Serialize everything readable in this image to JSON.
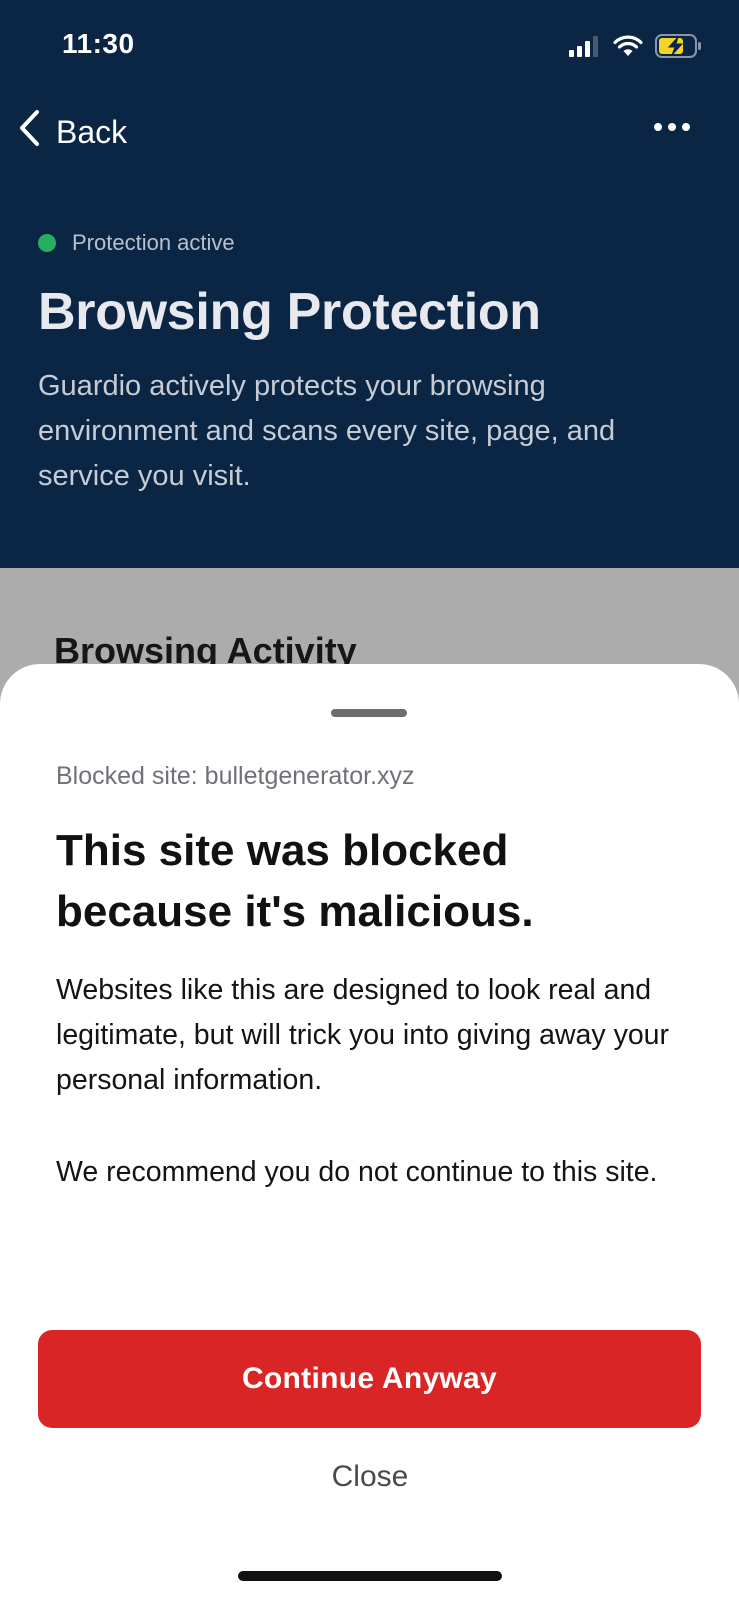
{
  "status_bar": {
    "time": "11:30",
    "icons": [
      "cellular-signal-icon",
      "wifi-icon",
      "battery-charging-icon"
    ],
    "battery_color": "#f5d327"
  },
  "nav": {
    "back_label": "Back",
    "back_icon": "chevron-left-icon",
    "more_icon": "more-horizontal-icon"
  },
  "header": {
    "status_label": "Protection active",
    "status_color": "#27ae60",
    "title": "Browsing Protection",
    "description": "Guardio actively protects your browsing environment and scans every site, page, and service you visit."
  },
  "background": {
    "section_title": "Browsing Activity"
  },
  "sheet": {
    "blocked_site": "Blocked site: bulletgenerator.xyz",
    "title": "This site was blocked because it's malicious.",
    "paragraph1": "Websites like this are designed to look real and legitimate, but will trick you into giving away your personal information.",
    "paragraph2": "We recommend you do not continue to this site.",
    "continue_label": "Continue Anyway",
    "continue_color": "#d92526",
    "close_label": "Close"
  },
  "colors": {
    "header_bg": "#0b2545",
    "overlay_bg": "#acacac"
  }
}
